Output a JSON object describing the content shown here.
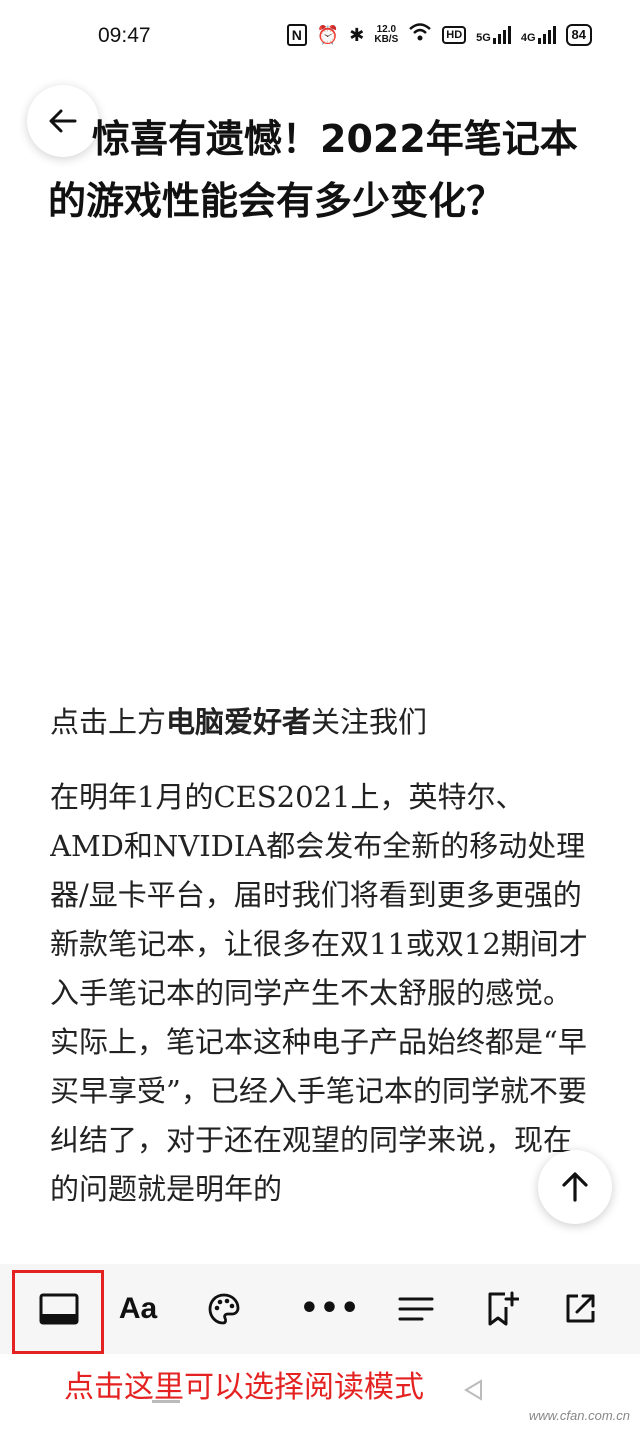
{
  "status_bar": {
    "time": "09:47",
    "nfc_label": "N",
    "net_speed_value": "12.0",
    "net_speed_unit": "KB/S",
    "hd_label": "HD",
    "sim1_label": "5G",
    "sim2_label": "4G",
    "battery": "84"
  },
  "article": {
    "title": "惊喜有遗憾！2022年笔记本的游戏性能会有多少变化？",
    "follow_prefix": "点击上方",
    "follow_account": "电脑爱好者",
    "follow_suffix": "关注我们",
    "paragraphs": [
      "在明年1月的CES2021上，英特尔、AMD和NVIDIA都会发布全新的移动处理器/显卡平台，届时我们将看到更多更强的新款笔记本，让很多在双11或双12期间才入手笔记本的同学产生不太舒服的感觉。",
      "实际上，笔记本这种电子产品始终都是“早买早享受”，已经入手笔记本的同学就不要纠结了，对于还在观望的同学来说，现在的问题就是明年的"
    ]
  },
  "toolbar": {
    "aa_label": "Aa",
    "more_label": "•••"
  },
  "annotation": {
    "hint_text": "点击这里可以选择阅读模式"
  },
  "watermark": "www.cfan.com.cn",
  "colors": {
    "accent_red": "#e52222",
    "toolbar_bg": "#f6f6f6"
  },
  "icons": [
    "back-arrow-icon",
    "scroll-top-icon",
    "reading-mode-icon",
    "font-size-icon",
    "theme-palette-icon",
    "more-icon",
    "outline-icon",
    "bookmark-add-icon",
    "open-external-icon"
  ]
}
